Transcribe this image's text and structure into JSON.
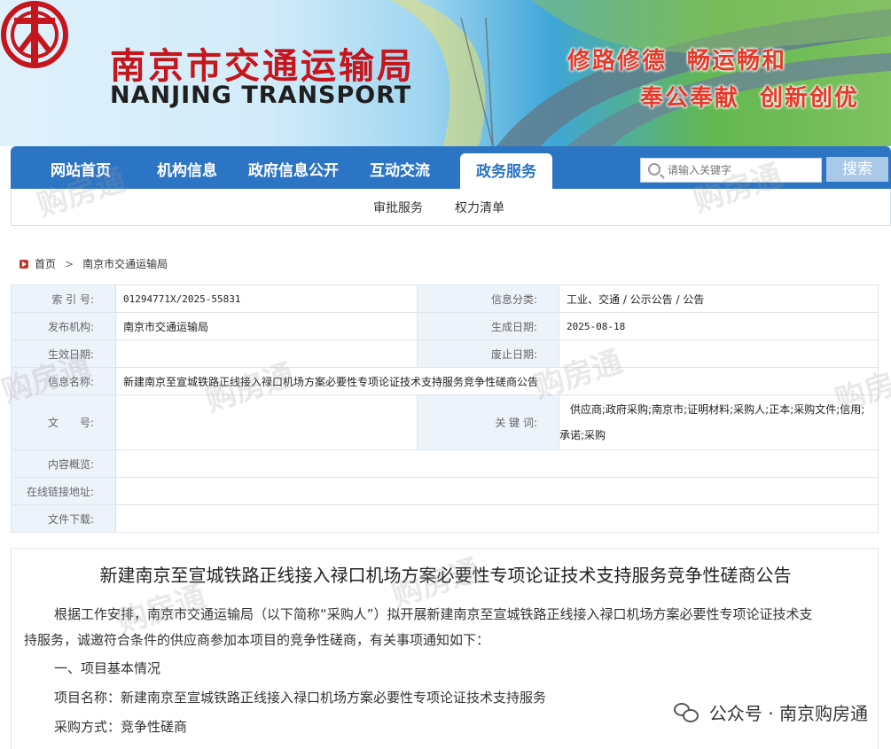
{
  "header": {
    "org_name_cn": "南京市交通运输局",
    "org_name_en": "NANJING TRANSPORT",
    "slogans": [
      "修路修德",
      "畅运畅和",
      "奉公奉献",
      "创新创优"
    ]
  },
  "nav": {
    "items": [
      "网站首页",
      "机构信息",
      "政府信息公开",
      "互动交流",
      "政务服务"
    ],
    "active_index": 4,
    "search_placeholder": "请输入关键字",
    "search_button": "搜索",
    "sub_items": [
      "审批服务",
      "权力清单"
    ]
  },
  "breadcrumb": {
    "home": "首页",
    "separator": ">",
    "current": "南京市交通运输局"
  },
  "info": {
    "index_label": "索 引 号:",
    "index_value": "01294771X/2025-55831",
    "category_label": "信息分类:",
    "category_value": "工业、交通 / 公示公告 / 公告",
    "publisher_label": "发布机构:",
    "publisher_value": "南京市交通运输局",
    "created_label": "生成日期:",
    "created_value": "2025-08-18",
    "effective_label": "生效日期:",
    "effective_value": "",
    "abolished_label": "废止日期:",
    "abolished_value": "",
    "name_label": "信息名称:",
    "name_value": "新建南京至宣城铁路正线接入禄口机场方案必要性专项论证技术支持服务竞争性磋商公告",
    "doc_label": "文　　号:",
    "doc_value": "",
    "keywords_label": "关 键 词:",
    "keywords_line1": "供应商;政府采购;南京市;证明材料;采购人;正本;采购文件;信用;",
    "keywords_line2": "承诺;采购",
    "overview_label": "内容概览:",
    "overview_value": "",
    "link_label": "在线链接地址:",
    "link_value": "",
    "download_label": "文件下载:",
    "download_value": ""
  },
  "article": {
    "title": "新建南京至宣城铁路正线接入禄口机场方案必要性专项论证技术支持服务竞争性磋商公告",
    "para1_line1": "根据工作安排，南京市交通运输局（以下简称“采购人”）拟开展新建南京至宣城铁路正线接入禄口机场方案必要性专项论证技术支",
    "para1_line2": "持服务，诚邀符合条件的供应商参加本项目的竞争性磋商，有关事项通知如下：",
    "section1": "一、项目基本情况",
    "project_name": "项目名称：新建南京至宣城铁路正线接入禄口机场方案必要性专项论证技术支持服务",
    "procurement_method": "采购方式：竞争性磋商"
  },
  "watermark": {
    "text": "购房通",
    "tag": "公众号 · 南京购房通"
  },
  "colors": {
    "nav_blue": "#2c74c4",
    "brand_red": "#c4161c",
    "slogan_red": "#e53a2a",
    "label_bg": "#edf3fa"
  }
}
